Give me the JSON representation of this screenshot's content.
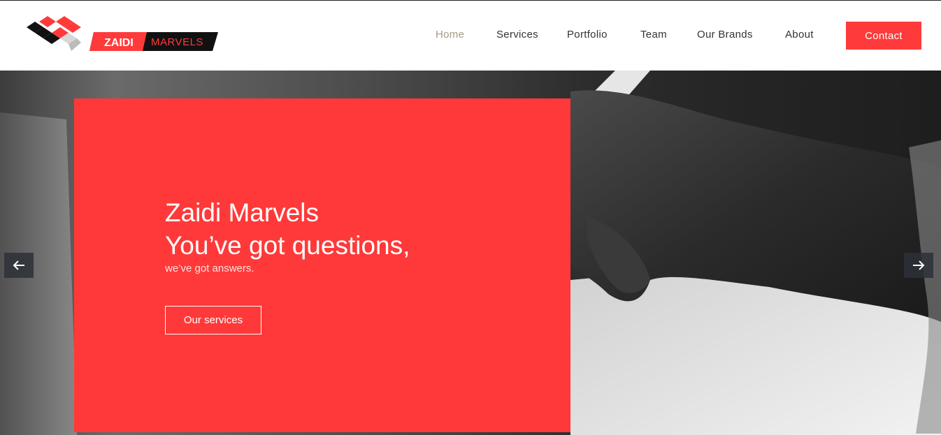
{
  "brand": {
    "name_part1": "ZAIDI",
    "name_part2": "MARVELS",
    "accent_color": "#ff3a3a"
  },
  "nav": {
    "items": [
      {
        "label": "Home",
        "active": true
      },
      {
        "label": "Services",
        "active": false
      },
      {
        "label": "Portfolio",
        "active": false
      },
      {
        "label": "Team",
        "active": false
      },
      {
        "label": "Our Brands",
        "active": false
      },
      {
        "label": "About",
        "active": false
      }
    ],
    "contact_label": "Contact"
  },
  "hero": {
    "title_line1": "Zaidi Marvels",
    "title_line2": "You’ve got questions,",
    "subtitle": "we’ve got answers.",
    "button_label": "Our services",
    "prev_icon": "arrow-left-icon",
    "next_icon": "arrow-right-icon"
  }
}
